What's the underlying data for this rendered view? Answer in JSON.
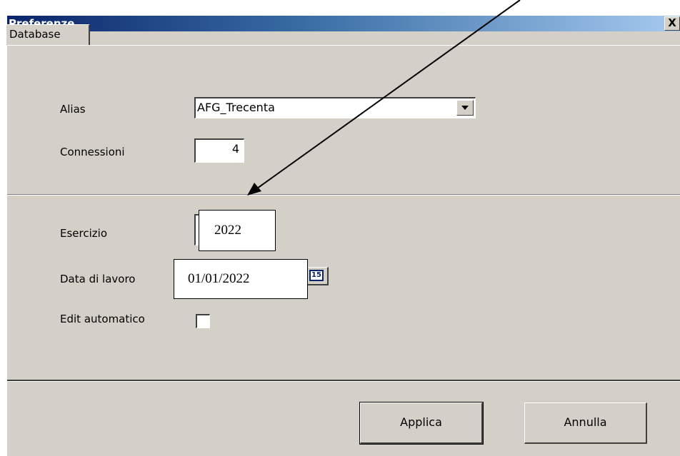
{
  "window": {
    "title": "Preferenze",
    "close_symbol": "X"
  },
  "tabs": [
    {
      "label": "Database",
      "selected": true
    }
  ],
  "form": {
    "alias": {
      "label": "Alias",
      "value": "AFG_Trecenta"
    },
    "connessioni": {
      "label": "Connessioni",
      "value": "4"
    },
    "esercizio": {
      "label": "Esercizio",
      "value": "2022"
    },
    "data_lavoro": {
      "label": "Data di lavoro",
      "value": "01/01/2022",
      "calendar_icon_text": "15"
    },
    "edit_automatico": {
      "label": "Edit automatico",
      "checked": false
    }
  },
  "buttons": {
    "apply": "Applica",
    "cancel": "Annulla"
  },
  "icons": [
    "close-icon",
    "dropdown-arrow-icon",
    "calendar-icon",
    "annotation-arrow"
  ],
  "colors": {
    "face": "#d4d0c8",
    "title_start": "#0a246a",
    "title_end": "#a6caf0"
  }
}
